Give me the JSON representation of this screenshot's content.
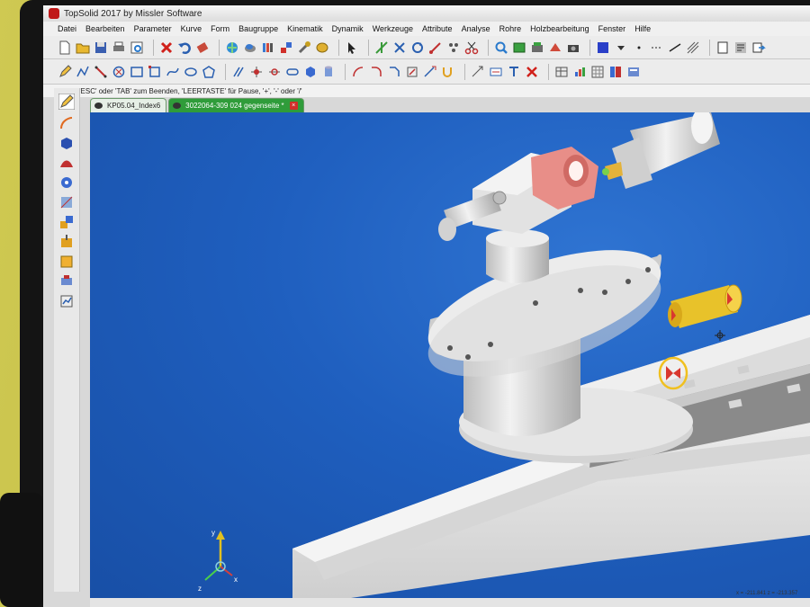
{
  "window": {
    "title": "TopSolid 2017 by Missler Software"
  },
  "menu": {
    "items": [
      "Datei",
      "Bearbeiten",
      "Parameter",
      "Kurve",
      "Form",
      "Baugruppe",
      "Kinematik",
      "Dynamik",
      "Werkzeuge",
      "Attribute",
      "Analyse",
      "Rohre",
      "Holzbearbeitung",
      "Fenster",
      "Hilfe"
    ]
  },
  "statusline": {
    "prompt": "'ESC' oder 'TAB' zum Beenden, 'LEERTASTE' für Pause, '+', '-' oder '/'"
  },
  "tabs": [
    {
      "label": "KP05.04_Index6",
      "active": false
    },
    {
      "label": "3022064-309 024 gegenseite *",
      "active": true,
      "close": "×"
    }
  ],
  "coords": {
    "x": "x = -211.841",
    "z": "z = -213.357"
  },
  "axis": {
    "x": "x",
    "y": "y",
    "z": "z"
  },
  "colors": {
    "viewport": "#1f5fbf",
    "part": "#e3e3e3",
    "highlight": "#f0c020",
    "red": "#d9382f",
    "tab_active": "#2f9c3a"
  }
}
